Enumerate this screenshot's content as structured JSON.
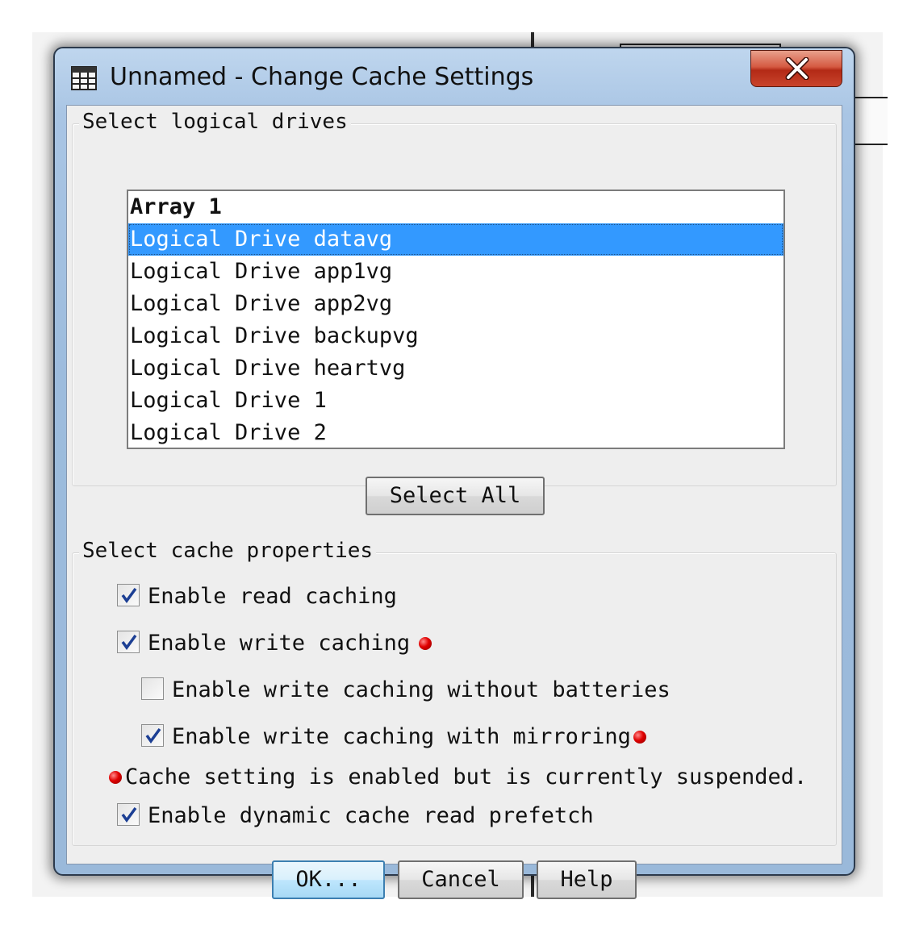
{
  "window": {
    "title": "Unnamed - Change Cache Settings",
    "close_glyph": "X"
  },
  "drives_group": {
    "title": "Select logical drives",
    "items": [
      {
        "label": "Array 1",
        "kind": "header",
        "selected": false
      },
      {
        "label": "Logical Drive datavg",
        "kind": "drive",
        "selected": true
      },
      {
        "label": "Logical Drive app1vg",
        "kind": "drive",
        "selected": false
      },
      {
        "label": "Logical Drive app2vg",
        "kind": "drive",
        "selected": false
      },
      {
        "label": "Logical Drive backupvg",
        "kind": "drive",
        "selected": false
      },
      {
        "label": "Logical Drive heartvg",
        "kind": "drive",
        "selected": false
      },
      {
        "label": "Logical Drive 1",
        "kind": "drive",
        "selected": false
      },
      {
        "label": "Logical Drive 2",
        "kind": "drive",
        "selected": false
      }
    ],
    "select_all_label": "Select All"
  },
  "cache_group": {
    "title": "Select cache properties",
    "read_caching": {
      "label": "Enable read caching",
      "checked": true
    },
    "write_caching": {
      "label": "Enable write caching",
      "checked": true,
      "suspended_marker": true
    },
    "write_no_batteries": {
      "label": "Enable write caching without batteries",
      "checked": false
    },
    "write_mirroring": {
      "label": "Enable write caching with mirroring",
      "checked": true,
      "suspended_marker": true
    },
    "suspended_note": "Cache setting is enabled but is currently suspended.",
    "dynamic_prefetch": {
      "label": "Enable dynamic cache read prefetch",
      "checked": true
    }
  },
  "buttons": {
    "ok": "OK...",
    "cancel": "Cancel",
    "help": "Help"
  },
  "colors": {
    "selection": "#3399ff",
    "suspended_dot": "#e00000",
    "title_bar": "#a9c5e4",
    "close_button": "#c9442c"
  },
  "icons": {
    "app": "table-grid-icon",
    "close": "close-icon",
    "check": "checkmark-icon",
    "status": "red-dot-icon"
  }
}
